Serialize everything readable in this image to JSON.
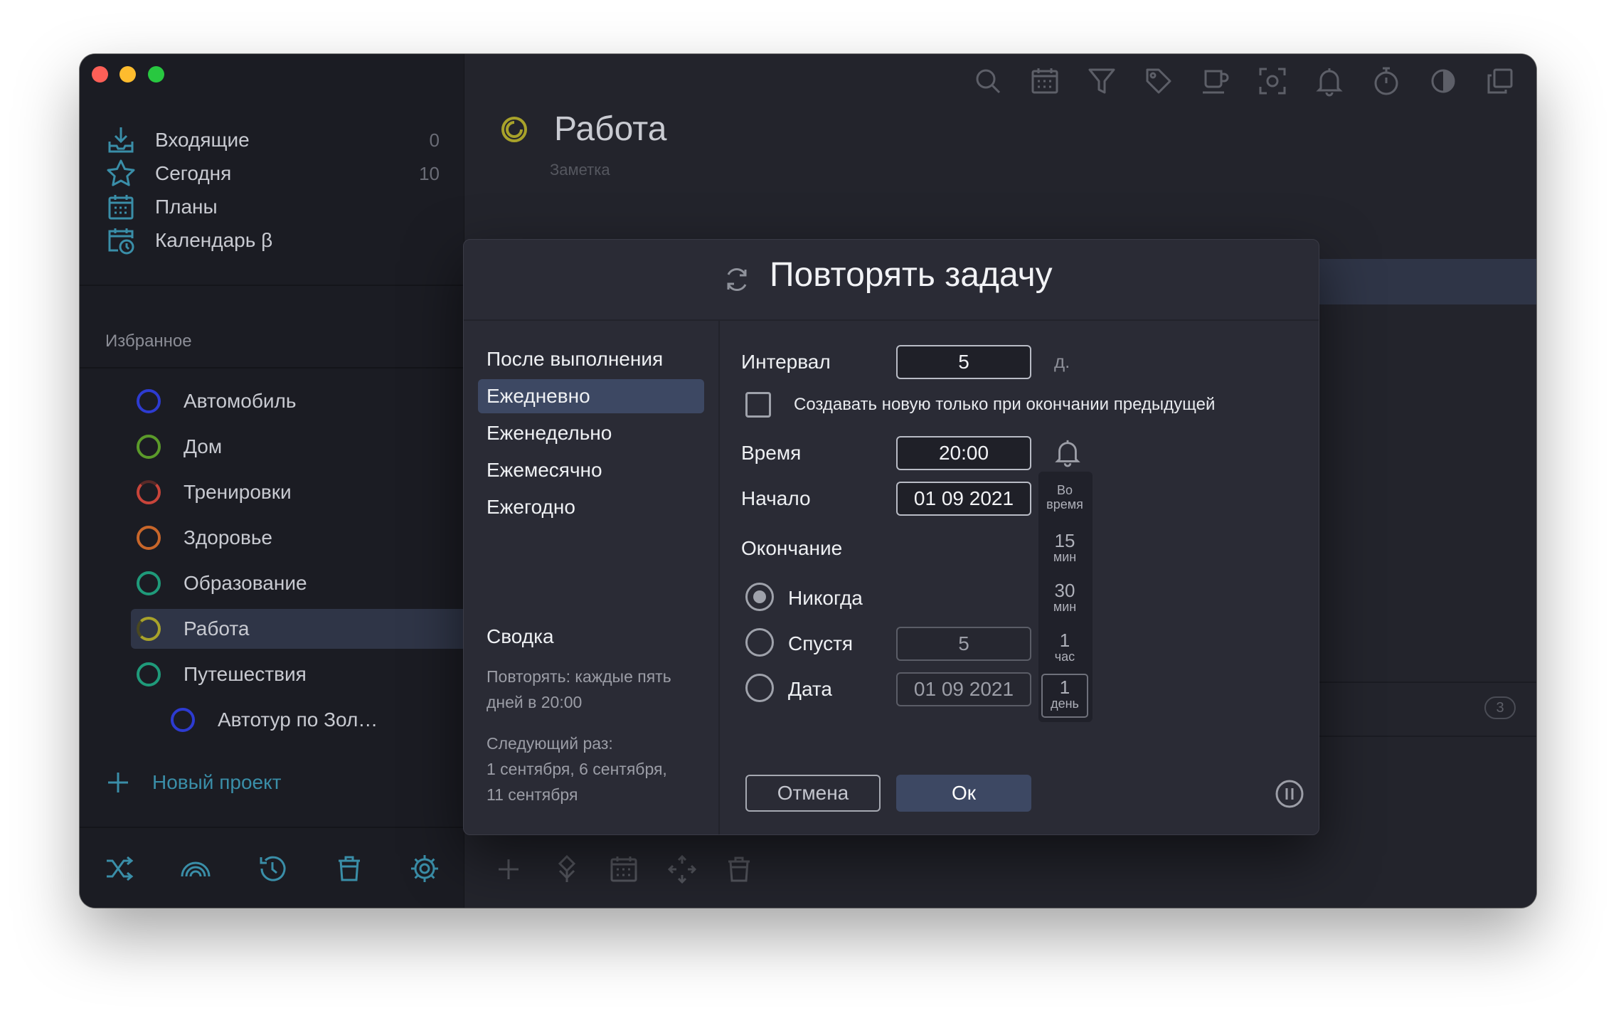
{
  "sidebar": {
    "nav": [
      {
        "label": "Входящие",
        "count": "0",
        "icon": "inbox-icon"
      },
      {
        "label": "Сегодня",
        "count": "10",
        "icon": "star-icon"
      },
      {
        "label": "Планы",
        "count": "",
        "icon": "calendar-grid-icon"
      },
      {
        "label": "Календарь β",
        "count": "",
        "icon": "calendar-clock-icon"
      }
    ],
    "favorites_title": "Избранное",
    "projects": [
      {
        "label": "Автомобиль",
        "color": "#2d3bd1"
      },
      {
        "label": "Дом",
        "color": "#5b9a2a"
      },
      {
        "label": "Тренировки",
        "color": "#c8443a"
      },
      {
        "label": "Здоровье",
        "color": "#c8662a"
      },
      {
        "label": "Образование",
        "color": "#1f9a7a"
      },
      {
        "label": "Работа",
        "color": "#a8a22a"
      },
      {
        "label": "Путешествия",
        "color": "#1f9a7a"
      },
      {
        "label": "Автотур по Зол…",
        "color": "#2d3bd1"
      }
    ],
    "new_project": "Новый проект",
    "bottom_icons": [
      "shuffle-icon",
      "rainbow-icon",
      "history-icon",
      "trash-icon",
      "settings-icon"
    ]
  },
  "main": {
    "title": "Работа",
    "note_placeholder": "Заметка",
    "toolbar_icons": [
      "search-icon",
      "calendar-icon",
      "filter-icon",
      "tag-icon",
      "coffee-icon",
      "focus-icon",
      "bell-icon",
      "timer-icon",
      "theme-icon",
      "copy-icon"
    ],
    "badge_count": "3",
    "bottom_icons": [
      "add-icon",
      "move-icon",
      "calendar-icon",
      "arrows-icon",
      "trash-icon",
      "cloud-icon"
    ]
  },
  "dialog": {
    "title": "Повторять задачу",
    "frequencies": [
      "После выполнения",
      "Ежедневно",
      "Еженедельно",
      "Ежемесячно",
      "Ежегодно"
    ],
    "selected_frequency": "Ежедневно",
    "summary": {
      "title": "Сводка",
      "repeat_line1": "Повторять: каждые пять",
      "repeat_line2": "дней в 20:00",
      "next_title": "Следующий раз:",
      "next_line1": "1 сентября, 6 сентября,",
      "next_line2": "11 сентября"
    },
    "interval": {
      "label": "Интервал",
      "value": "5",
      "unit": "д."
    },
    "create_only_after": {
      "label": "Создавать новую только при окончании предыдущей",
      "checked": false
    },
    "time": {
      "label": "Время",
      "value": "20:00"
    },
    "start": {
      "label": "Начало",
      "value": "01 09 2021"
    },
    "ending": {
      "label": "Окончание",
      "options": [
        {
          "label": "Никогда",
          "checked": true
        },
        {
          "label": "Спустя",
          "value": "5",
          "checked": false
        },
        {
          "label": "Дата",
          "value": "01 09 2021",
          "checked": false
        }
      ]
    },
    "reminder_options": [
      {
        "big": "Во",
        "small": "время"
      },
      {
        "big": "15",
        "small": "мин"
      },
      {
        "big": "30",
        "small": "мин"
      },
      {
        "big": "1",
        "small": "час"
      },
      {
        "big": "1",
        "small": "день"
      }
    ],
    "selected_reminder": "1 день",
    "cancel_label": "Отмена",
    "ok_label": "Ок"
  }
}
